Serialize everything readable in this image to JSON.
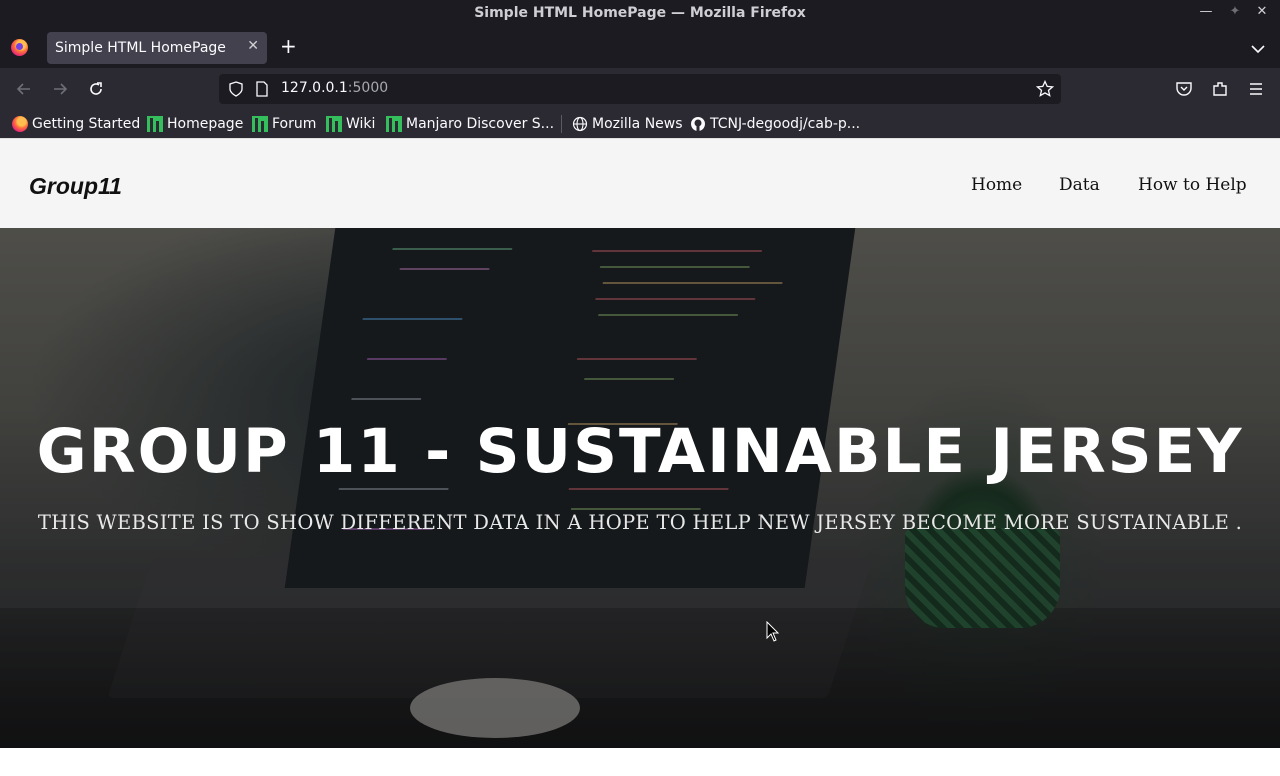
{
  "window": {
    "title": "Simple HTML HomePage — Mozilla Firefox"
  },
  "tabs": [
    {
      "label": "Simple HTML HomePage",
      "active": true
    }
  ],
  "urlbar": {
    "host": "127.0.0.1",
    "port": ":5000"
  },
  "bookmarks": [
    {
      "label": "Getting Started",
      "icon": "firefox-icon"
    },
    {
      "label": "Homepage",
      "icon": "manjaro-icon"
    },
    {
      "label": "Forum",
      "icon": "manjaro-icon"
    },
    {
      "label": "Wiki",
      "icon": "manjaro-icon"
    },
    {
      "label": "Manjaro Discover S...",
      "icon": "manjaro-icon"
    },
    {
      "label": "Mozilla News",
      "icon": "globe-icon"
    },
    {
      "label": "TCNJ-degoodj/cab-p...",
      "icon": "github-icon"
    }
  ],
  "site": {
    "logo": "Group11",
    "nav": [
      {
        "label": "Home"
      },
      {
        "label": "Data"
      },
      {
        "label": "How to Help"
      }
    ],
    "hero": {
      "title": "GROUP 11 - SUSTAINABLE JERSEY",
      "subtitle": "THIS WEBSITE IS TO SHOW DIFFERENT DATA IN A HOPE TO HELP NEW JERSEY BECOME MORE SUSTAINABLE ."
    }
  },
  "colors": {
    "chrome_dark": "#1c1b22",
    "toolbar": "#2b2a33",
    "tab_active": "#42414d",
    "header_bg": "#f5f5f5"
  }
}
